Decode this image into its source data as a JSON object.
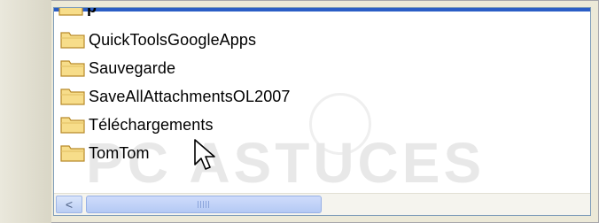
{
  "folder_list": {
    "partial_item": "p",
    "items": [
      {
        "label": "QuickToolsGoogleApps",
        "icon": "folder-icon"
      },
      {
        "label": "Sauvegarde",
        "icon": "folder-icon"
      },
      {
        "label": "SaveAllAttachmentsOL2007",
        "icon": "folder-icon"
      },
      {
        "label": "Téléchargements",
        "icon": "folder-icon"
      },
      {
        "label": "TomTom",
        "icon": "folder-icon"
      }
    ]
  },
  "watermark": {
    "text": "PC ASTUCES"
  },
  "colors": {
    "selection_bar": "#2b5ec6",
    "border": "#7f9db9",
    "folder_fill": "#f7dd8a",
    "folder_edge": "#b88a2a"
  },
  "scrollbar": {
    "left_arrow": "<"
  }
}
